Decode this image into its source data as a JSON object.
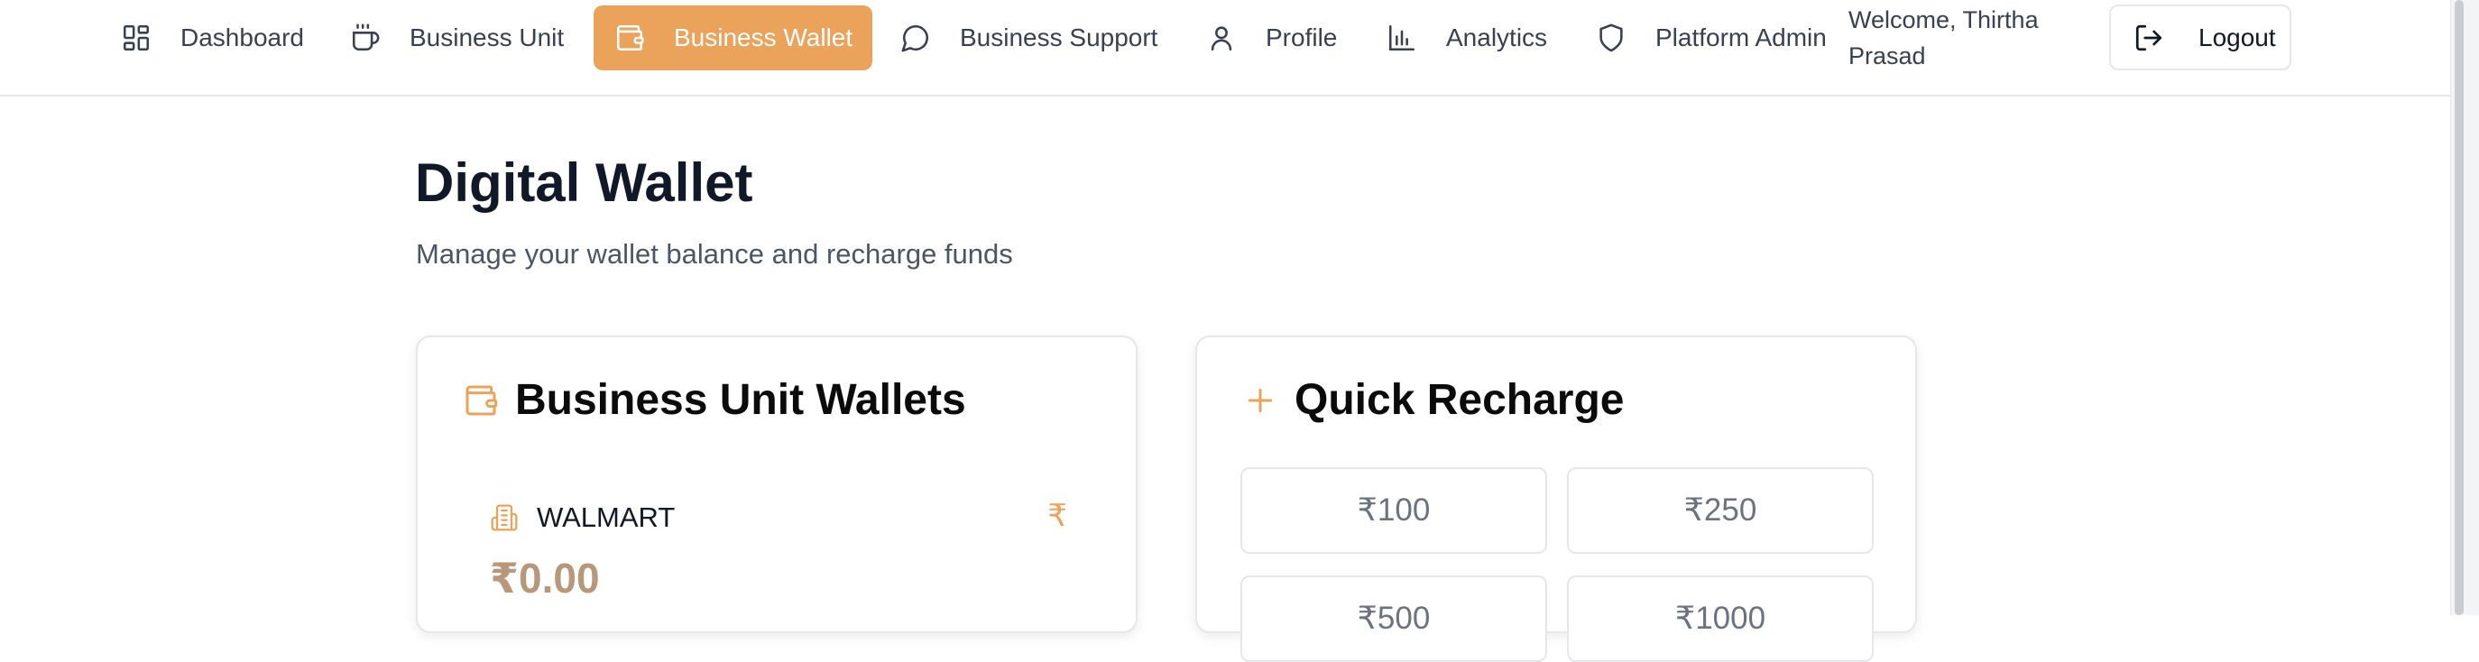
{
  "nav": {
    "items": [
      {
        "label": "Dashboard",
        "icon": "dashboard-icon"
      },
      {
        "label": "Business Unit",
        "icon": "coffee-cup-icon"
      },
      {
        "label": "Business Wallet",
        "icon": "wallet-icon"
      },
      {
        "label": "Business Support",
        "icon": "chat-bubble-icon"
      },
      {
        "label": "Profile",
        "icon": "user-icon"
      },
      {
        "label": "Analytics",
        "icon": "bar-chart-icon"
      },
      {
        "label": "Platform Admin",
        "icon": "shield-icon"
      }
    ],
    "active_item": "Business Wallet",
    "welcome": "Welcome, Thirtha Prasad",
    "logout_label": "Logout"
  },
  "page": {
    "title": "Digital Wallet",
    "subtitle": "Manage your wallet balance and recharge funds"
  },
  "wallets": {
    "title": "Business Unit Wallets",
    "icon": "wallet-icon",
    "items": [
      {
        "name": "WALMART",
        "balance": "₹0.00",
        "currency_symbol": "₹"
      }
    ]
  },
  "recharge": {
    "title": "Quick Recharge",
    "icon": "plus-icon",
    "amounts": [
      "₹100",
      "₹250",
      "₹500",
      "₹1000"
    ]
  },
  "colors": {
    "accent": "#eba25b",
    "balance": "#b9977a",
    "border": "#e5e7eb"
  }
}
